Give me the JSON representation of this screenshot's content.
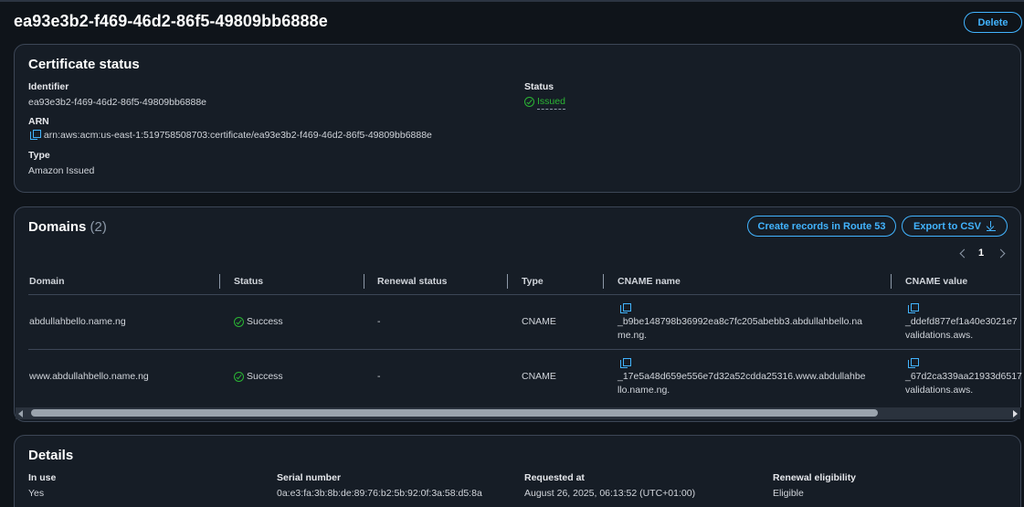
{
  "page": {
    "title": "ea93e3b2-f469-46d2-86f5-49809bb6888e",
    "delete_label": "Delete"
  },
  "certificate_status": {
    "heading": "Certificate status",
    "identifier_label": "Identifier",
    "identifier_value": "ea93e3b2-f469-46d2-86f5-49809bb6888e",
    "status_label": "Status",
    "status_value": "Issued",
    "arn_label": "ARN",
    "arn_value": "arn:aws:acm:us-east-1:519758508703:certificate/ea93e3b2-f469-46d2-86f5-49809bb6888e",
    "type_label": "Type",
    "type_value": "Amazon Issued"
  },
  "domains": {
    "heading": "Domains",
    "count": "(2)",
    "create_records_label": "Create records in Route 53",
    "export_label": "Export to CSV",
    "page_number": "1",
    "columns": [
      "Domain",
      "Status",
      "Renewal status",
      "Type",
      "CNAME name",
      "CNAME value"
    ],
    "rows": [
      {
        "domain": "abdullahbello.name.ng",
        "status": "Success",
        "renewal_status": "-",
        "type": "CNAME",
        "cname_name_1": "_b9be148798b36992ea8c7fc205abebb3.abdullahbello.na",
        "cname_name_2": "me.ng.",
        "cname_value_1": "_ddefd877ef1a40e3021e7",
        "cname_value_2": "validations.aws."
      },
      {
        "domain": "www.abdullahbello.name.ng",
        "status": "Success",
        "renewal_status": "-",
        "type": "CNAME",
        "cname_name_1": "_17e5a48d659e556e7d32a52cdda25316.www.abdullahbe",
        "cname_name_2": "llo.name.ng.",
        "cname_value_1": "_67d2ca339aa21933d6517",
        "cname_value_2": "validations.aws."
      }
    ]
  },
  "details": {
    "heading": "Details",
    "in_use_label": "In use",
    "in_use_value": "Yes",
    "serial_label": "Serial number",
    "serial_value": "0a:e3:fa:3b:8b:de:89:76:b2:5b:92:0f:3a:58:d5:8a",
    "requested_label": "Requested at",
    "requested_value": "August 26, 2025, 06:13:52 (UTC+01:00)",
    "renewal_label": "Renewal eligibility",
    "renewal_value": "Eligible"
  },
  "colors": {
    "accent": "#42b4ff",
    "success": "#2bb534",
    "background": "#0f141a",
    "panel": "#161d26"
  }
}
